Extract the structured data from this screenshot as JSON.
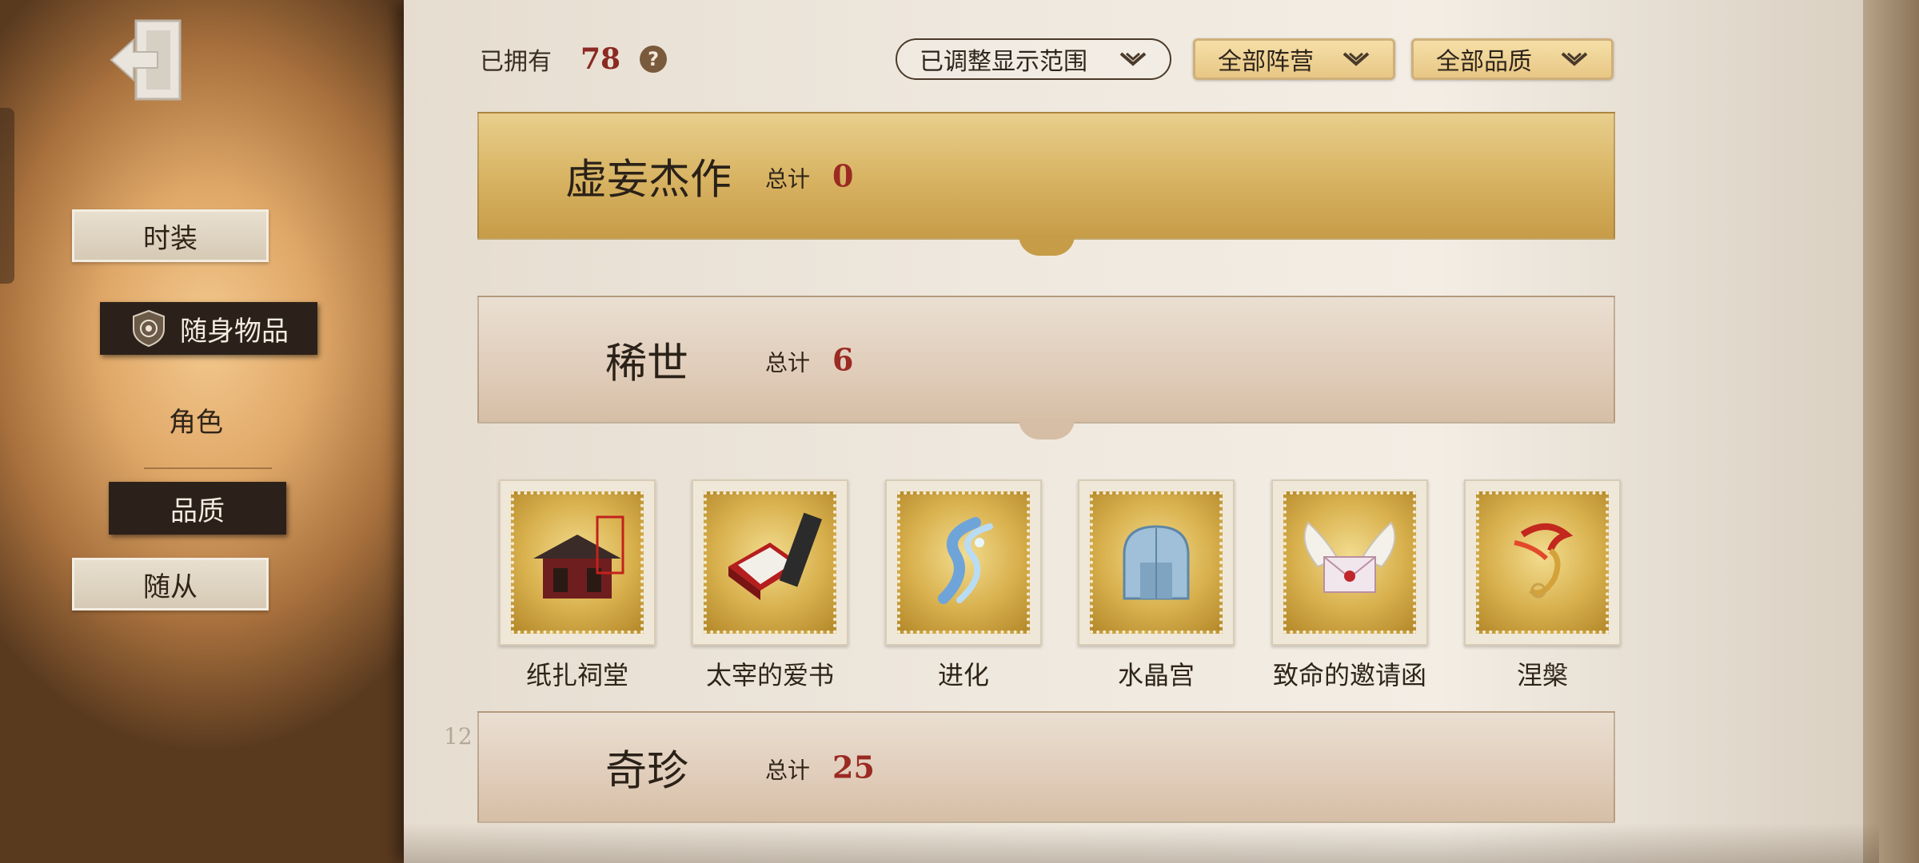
{
  "nav": {
    "items": [
      {
        "label": "时装"
      },
      {
        "label": "随身物品"
      },
      {
        "label": "角色"
      },
      {
        "label": "品质"
      },
      {
        "label": "随从"
      }
    ]
  },
  "header": {
    "owned_label": "已拥有",
    "owned_count": "78",
    "help_symbol": "?",
    "filters": [
      {
        "label": "已调整显示范围"
      },
      {
        "label": "全部阵营"
      },
      {
        "label": "全部品质"
      }
    ]
  },
  "sections": [
    {
      "title": "虚妄杰作",
      "total_label": "总计",
      "total": "0"
    },
    {
      "title": "稀世",
      "total_label": "总计",
      "total": "6"
    },
    {
      "title": "奇珍",
      "total_label": "总计",
      "total": "25"
    }
  ],
  "items": [
    {
      "name": "纸扎祠堂",
      "icon": "paper-shrine-icon"
    },
    {
      "name": "太宰的爱书",
      "icon": "book-icon"
    },
    {
      "name": "进化",
      "icon": "crystal-dna-icon"
    },
    {
      "name": "水晶宫",
      "icon": "crystal-palace-icon"
    },
    {
      "name": "致命的邀请函",
      "icon": "winged-letter-icon"
    },
    {
      "name": "涅槃",
      "icon": "phoenix-icon"
    }
  ],
  "page_marker": "12",
  "colors": {
    "accent_red": "#9a2a22",
    "gold": "#d7b261",
    "nav_dark": "#2b211a"
  }
}
